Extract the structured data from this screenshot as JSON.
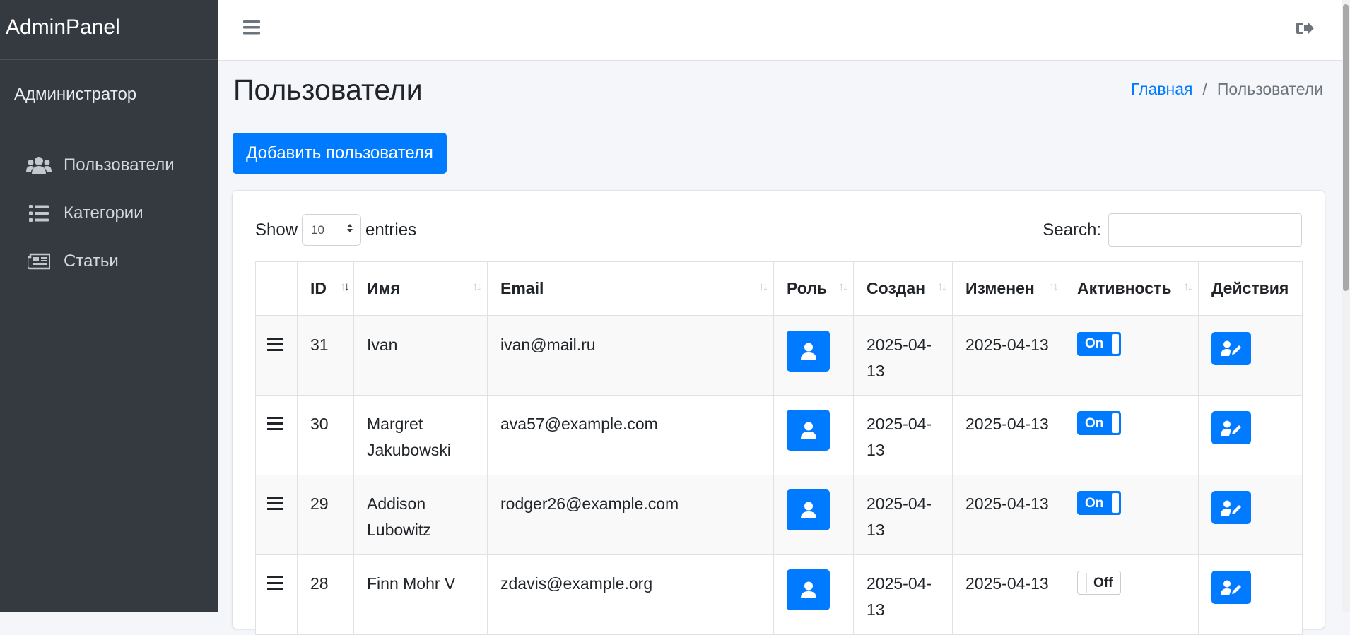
{
  "brand": "AdminPanel",
  "sidebar": {
    "user": "Администратор",
    "items": [
      {
        "label": "Пользователи",
        "icon": "users-icon"
      },
      {
        "label": "Категории",
        "icon": "list-icon"
      },
      {
        "label": "Статьи",
        "icon": "newspaper-icon"
      }
    ]
  },
  "topbar": {
    "menu_icon": "hamburger-icon",
    "logout_icon": "sign-out-icon"
  },
  "page": {
    "title": "Пользователи",
    "breadcrumb": {
      "home": "Главная",
      "separator": "/",
      "current": "Пользователи"
    },
    "add_button": "Добавить пользователя"
  },
  "table_controls": {
    "show": "Show",
    "entries_value": "10",
    "entries": "entries",
    "search_label": "Search:",
    "search_value": ""
  },
  "table": {
    "columns": [
      "",
      "ID",
      "Имя",
      "Email",
      "Роль",
      "Создан",
      "Изменен",
      "Активность",
      "Действия"
    ],
    "sort": {
      "column": "ID",
      "direction": "desc"
    },
    "rows": [
      {
        "id": "31",
        "name": "Ivan",
        "email": "ivan@mail.ru",
        "created": "2025-04-13",
        "created_wrap": [
          "2025-04-",
          "13"
        ],
        "updated": "2025-04-13",
        "active": "On"
      },
      {
        "id": "30",
        "name": "Margret Jakubowski",
        "email": "ava57@example.com",
        "created": "2025-04-13",
        "created_wrap": [
          "2025-04-",
          "13"
        ],
        "updated": "2025-04-13",
        "active": "On"
      },
      {
        "id": "29",
        "name": "Addison Lubowitz",
        "email": "rodger26@example.com",
        "created": "2025-04-13",
        "created_wrap": [
          "2025-04-",
          "13"
        ],
        "updated": "2025-04-13",
        "active": "On"
      },
      {
        "id": "28",
        "name": "Finn Mohr V",
        "email": "zdavis@example.org",
        "created": "2025-04-13",
        "created_wrap": [
          "2025-04-",
          "13"
        ],
        "updated": "2025-04-13",
        "active": "Off"
      }
    ]
  },
  "colors": {
    "primary": "#007bff",
    "sidebar_bg": "#343a40",
    "content_bg": "#f4f6f9"
  }
}
